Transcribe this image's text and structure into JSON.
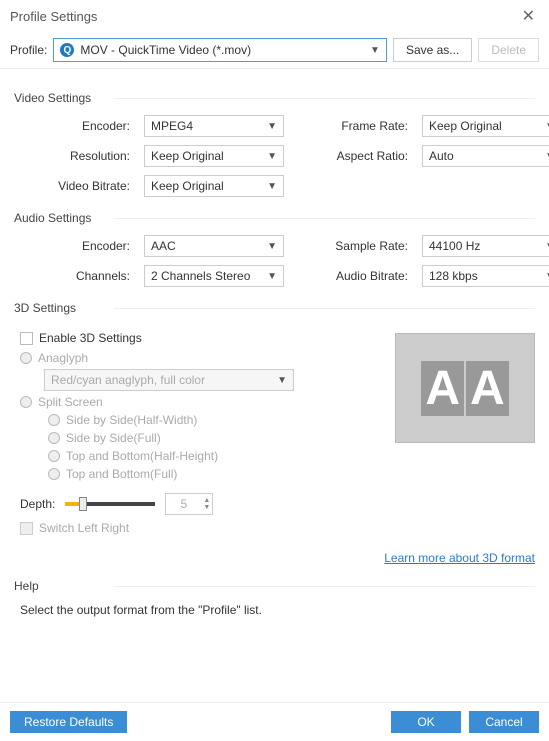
{
  "title": "Profile Settings",
  "profile": {
    "label": "Profile:",
    "icon_letter": "Q",
    "value": "MOV - QuickTime Video (*.mov)",
    "save_as": "Save as...",
    "delete": "Delete"
  },
  "video": {
    "heading": "Video Settings",
    "encoder_label": "Encoder:",
    "encoder": "MPEG4",
    "frame_rate_label": "Frame Rate:",
    "frame_rate": "Keep Original",
    "resolution_label": "Resolution:",
    "resolution": "Keep Original",
    "aspect_ratio_label": "Aspect Ratio:",
    "aspect_ratio": "Auto",
    "bitrate_label": "Video Bitrate:",
    "bitrate": "Keep Original"
  },
  "audio": {
    "heading": "Audio Settings",
    "encoder_label": "Encoder:",
    "encoder": "AAC",
    "sample_rate_label": "Sample Rate:",
    "sample_rate": "44100 Hz",
    "channels_label": "Channels:",
    "channels": "2 Channels Stereo",
    "bitrate_label": "Audio Bitrate:",
    "bitrate": "128 kbps"
  },
  "three_d": {
    "heading": "3D Settings",
    "enable": "Enable 3D Settings",
    "anaglyph": "Anaglyph",
    "anaglyph_mode": "Red/cyan anaglyph, full color",
    "split_screen": "Split Screen",
    "side_half": "Side by Side(Half-Width)",
    "side_full": "Side by Side(Full)",
    "top_half": "Top and Bottom(Half-Height)",
    "top_full": "Top and Bottom(Full)",
    "depth_label": "Depth:",
    "depth_value": "5",
    "switch": "Switch Left Right",
    "learn_more": "Learn more about 3D format"
  },
  "help": {
    "heading": "Help",
    "text": "Select the output format from the \"Profile\" list."
  },
  "footer": {
    "restore": "Restore Defaults",
    "ok": "OK",
    "cancel": "Cancel"
  }
}
